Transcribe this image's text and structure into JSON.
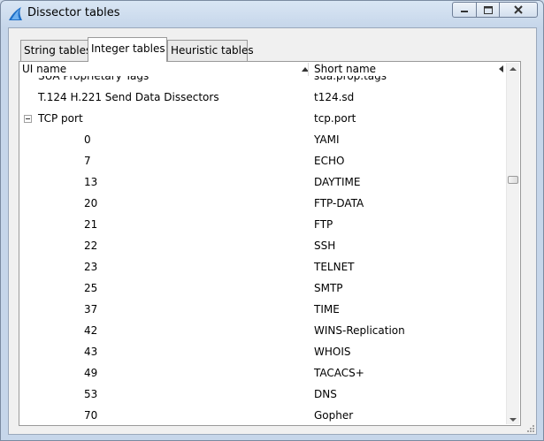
{
  "window": {
    "title": "Dissector tables",
    "accent_color": "#1f6fc7"
  },
  "tabs": [
    {
      "label": "String tables",
      "active": false
    },
    {
      "label": "Integer tables",
      "active": true
    },
    {
      "label": "Heuristic tables",
      "active": false
    }
  ],
  "columns": {
    "ui_name": "UI name",
    "short_name": "Short name"
  },
  "rows": [
    {
      "name": "SUA Proprietary Tags",
      "short": "sua.prop.tags",
      "level": 0
    },
    {
      "name": "T.124 H.221 Send Data Dissectors",
      "short": "t124.sd",
      "level": 0
    },
    {
      "name": "TCP port",
      "short": "tcp.port",
      "level": 0,
      "expanded": true
    },
    {
      "name": "0",
      "short": "YAMI",
      "level": 1
    },
    {
      "name": "7",
      "short": "ECHO",
      "level": 1
    },
    {
      "name": "13",
      "short": "DAYTIME",
      "level": 1
    },
    {
      "name": "20",
      "short": "FTP-DATA",
      "level": 1
    },
    {
      "name": "21",
      "short": "FTP",
      "level": 1
    },
    {
      "name": "22",
      "short": "SSH",
      "level": 1
    },
    {
      "name": "23",
      "short": "TELNET",
      "level": 1
    },
    {
      "name": "25",
      "short": "SMTP",
      "level": 1
    },
    {
      "name": "37",
      "short": "TIME",
      "level": 1
    },
    {
      "name": "42",
      "short": "WINS-Replication",
      "level": 1
    },
    {
      "name": "43",
      "short": "WHOIS",
      "level": 1
    },
    {
      "name": "49",
      "short": "TACACS+",
      "level": 1
    },
    {
      "name": "53",
      "short": "DNS",
      "level": 1
    },
    {
      "name": "70",
      "short": "Gopher",
      "level": 1
    }
  ]
}
